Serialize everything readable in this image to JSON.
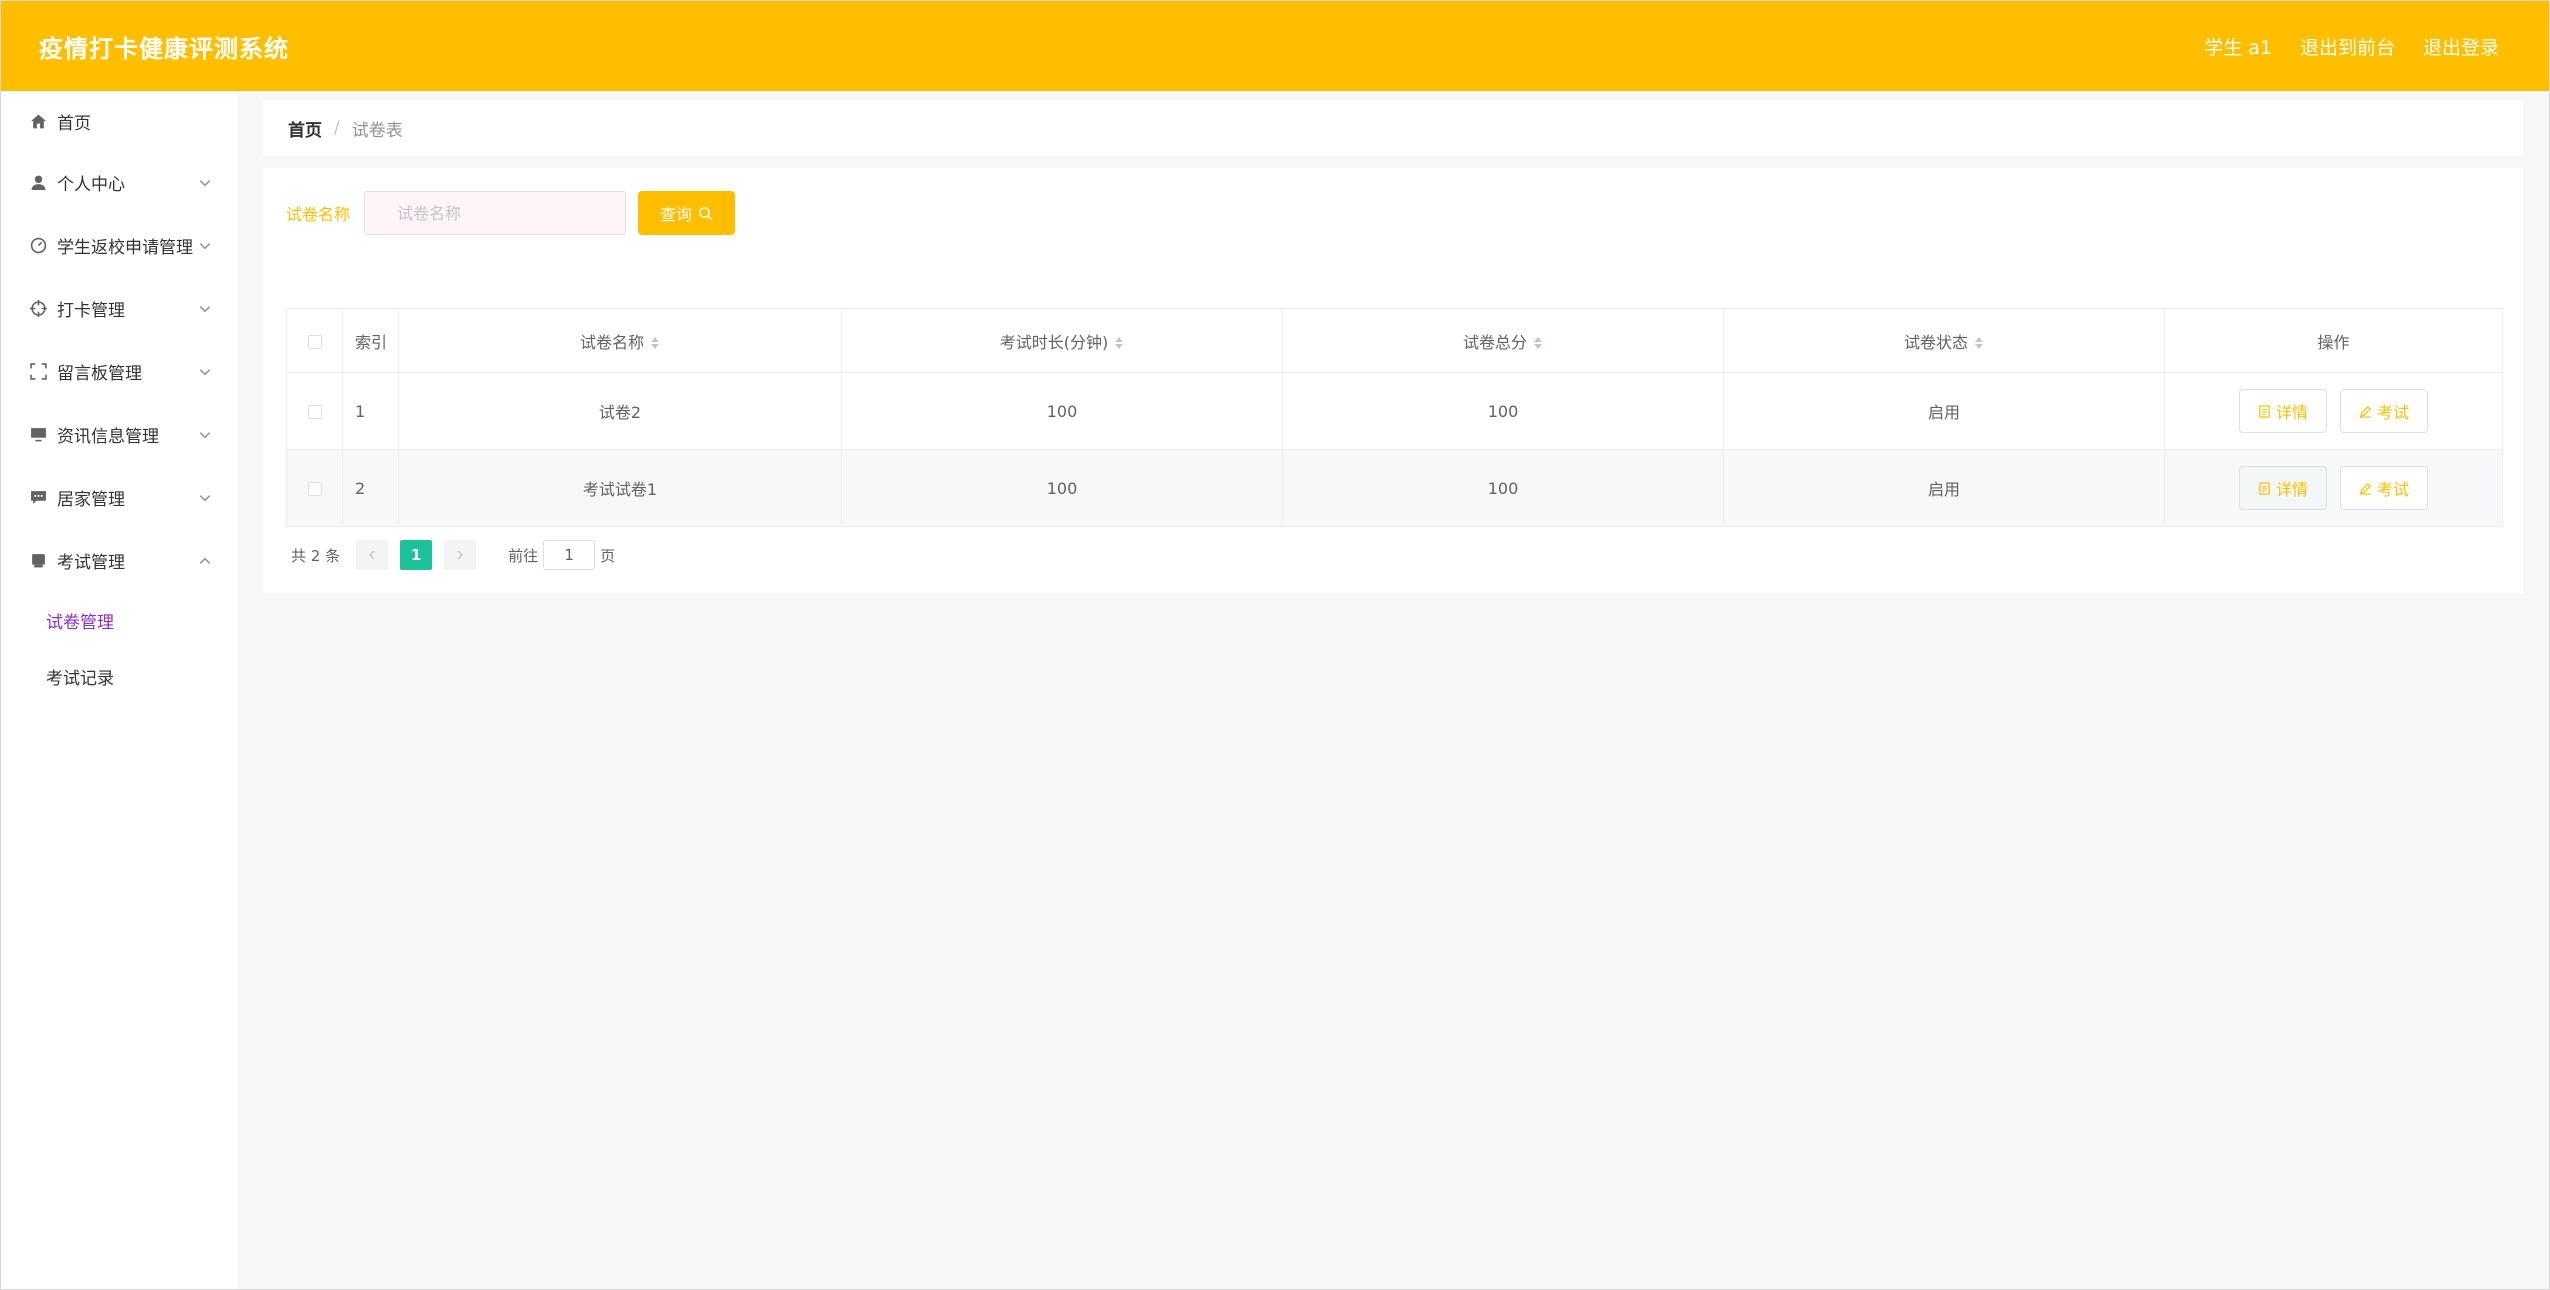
{
  "header": {
    "title": "疫情打卡健康评测系统",
    "user": "学生 a1",
    "to_front": "退出到前台",
    "logout": "退出登录"
  },
  "sidebar": {
    "items": [
      {
        "label": "首页",
        "icon": "home-icon"
      },
      {
        "label": "个人中心",
        "icon": "user-icon"
      },
      {
        "label": "学生返校申请管理",
        "icon": "gauge-icon"
      },
      {
        "label": "打卡管理",
        "icon": "crosshair-icon"
      },
      {
        "label": "留言板管理",
        "icon": "fullscreen-icon"
      },
      {
        "label": "资讯信息管理",
        "icon": "monitor-icon"
      },
      {
        "label": "居家管理",
        "icon": "chat-icon"
      },
      {
        "label": "考试管理",
        "icon": "printer-icon"
      }
    ],
    "sub_items": [
      {
        "label": "试卷管理",
        "active": true
      },
      {
        "label": "考试记录",
        "active": false
      }
    ]
  },
  "breadcrumb": {
    "home": "首页",
    "separator": "/",
    "current": "试卷表"
  },
  "search": {
    "label": "试卷名称",
    "placeholder": "试卷名称",
    "button": "查询"
  },
  "table": {
    "columns": [
      "索引",
      "试卷名称",
      "考试时长(分钟)",
      "试卷总分",
      "试卷状态",
      "操作"
    ],
    "rows": [
      {
        "index": "1",
        "name": "试卷2",
        "duration": "100",
        "score": "100",
        "status": "启用"
      },
      {
        "index": "2",
        "name": "考试试卷1",
        "duration": "100",
        "score": "100",
        "status": "启用"
      }
    ],
    "action_detail": "详情",
    "action_exam": "考试"
  },
  "pagination": {
    "total": "共 2 条",
    "current_page": "1",
    "goto_label": "前往",
    "goto_value": "1",
    "page_suffix": "页"
  },
  "colors": {
    "primary": "#ffbf00",
    "active_menu": "#8a2fc8",
    "page_active": "#1ec29a"
  }
}
